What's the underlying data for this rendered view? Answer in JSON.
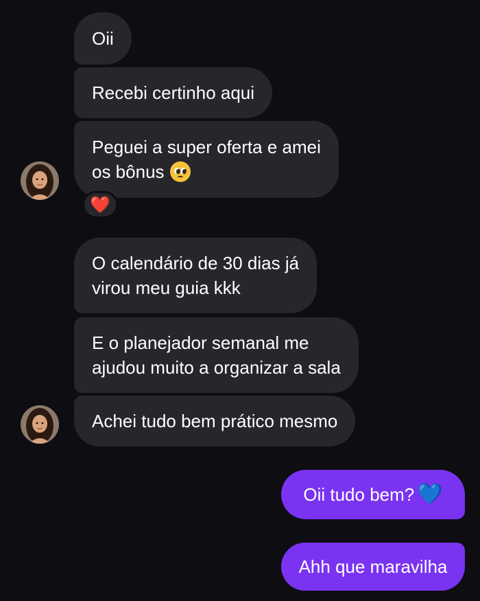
{
  "conversation": {
    "incoming": [
      {
        "text": "Oii"
      },
      {
        "text": "Recebi certinho aqui"
      },
      {
        "line1": "Peguei a super oferta e amei",
        "line2": "os bônus",
        "emoji": "pleading-face-emoji",
        "reaction": "❤️"
      },
      {
        "line1": "O calendário de 30 dias já",
        "line2": "virou meu guia kkk"
      },
      {
        "line1": "E o planejador semanal me",
        "line2": "ajudou muito a organizar a sala"
      },
      {
        "text": "Achei tudo bem prático mesmo"
      }
    ],
    "outgoing": [
      {
        "text": "Oii tudo bem?",
        "emoji": "💙"
      },
      {
        "text": "Ahh que maravilha"
      }
    ]
  },
  "colors": {
    "background": "#0d0d12",
    "incoming_bubble": "#26262b",
    "outgoing_bubble": "#7a33f0",
    "reaction_heart": "#e8112d",
    "blue_heart": "#2e8cf0"
  },
  "icons": {
    "avatar": "contact-avatar-photo",
    "reaction": "red-heart-reaction-icon"
  }
}
